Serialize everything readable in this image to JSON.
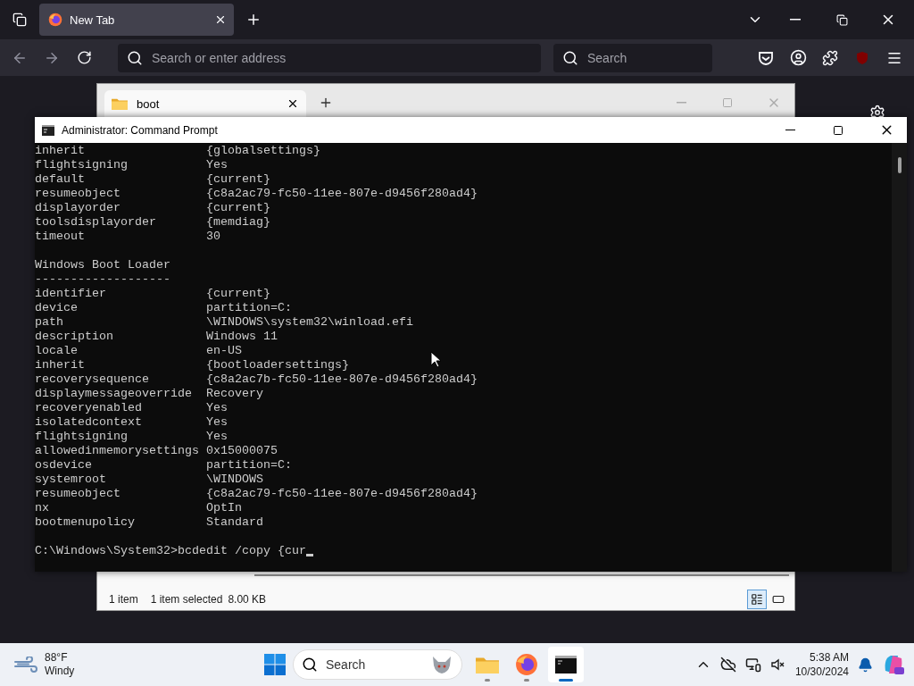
{
  "browser": {
    "tabs": [
      {
        "title": "New Tab",
        "selected": true
      }
    ],
    "address": {
      "placeholder": "Search or enter address"
    },
    "search": {
      "placeholder": "Search"
    }
  },
  "explorer": {
    "tabs": [
      {
        "title": "boot",
        "selected": true
      }
    ],
    "status": {
      "item_count": "1 item",
      "selection": "1 item selected",
      "size": "8.00 KB"
    },
    "views": [
      {
        "kind": "details",
        "selected": true
      },
      {
        "kind": "tiles",
        "selected": false
      }
    ]
  },
  "console": {
    "title": "Administrator: Command Prompt",
    "lines": [
      {
        "kind": "pair",
        "key": "inherit",
        "value": "{globalsettings}"
      },
      {
        "kind": "pair",
        "key": "flightsigning",
        "value": "Yes"
      },
      {
        "kind": "pair",
        "key": "default",
        "value": "{current}"
      },
      {
        "kind": "pair",
        "key": "resumeobject",
        "value": "{c8a2ac79-fc50-11ee-807e-d9456f280ad4}"
      },
      {
        "kind": "pair",
        "key": "displayorder",
        "value": "{current}"
      },
      {
        "kind": "pair",
        "key": "toolsdisplayorder",
        "value": "{memdiag}"
      },
      {
        "kind": "pair",
        "key": "timeout",
        "value": "30"
      },
      {
        "kind": "blank"
      },
      {
        "kind": "text",
        "text": "Windows Boot Loader"
      },
      {
        "kind": "text",
        "text": "-------------------"
      },
      {
        "kind": "pair",
        "key": "identifier",
        "value": "{current}"
      },
      {
        "kind": "pair",
        "key": "device",
        "value": "partition=C:"
      },
      {
        "kind": "pair",
        "key": "path",
        "value": "\\WINDOWS\\system32\\winload.efi"
      },
      {
        "kind": "pair",
        "key": "description",
        "value": "Windows 11"
      },
      {
        "kind": "pair",
        "key": "locale",
        "value": "en-US"
      },
      {
        "kind": "pair",
        "key": "inherit",
        "value": "{bootloadersettings}"
      },
      {
        "kind": "pair",
        "key": "recoverysequence",
        "value": "{c8a2ac7b-fc50-11ee-807e-d9456f280ad4}"
      },
      {
        "kind": "pair",
        "key": "displaymessageoverride",
        "value": "Recovery"
      },
      {
        "kind": "pair",
        "key": "recoveryenabled",
        "value": "Yes"
      },
      {
        "kind": "pair",
        "key": "isolatedcontext",
        "value": "Yes"
      },
      {
        "kind": "pair",
        "key": "flightsigning",
        "value": "Yes"
      },
      {
        "kind": "pair",
        "key": "allowedinmemorysettings",
        "value": "0x15000075"
      },
      {
        "kind": "pair",
        "key": "osdevice",
        "value": "partition=C:"
      },
      {
        "kind": "pair",
        "key": "systemroot",
        "value": "\\WINDOWS"
      },
      {
        "kind": "pair",
        "key": "resumeobject",
        "value": "{c8a2ac79-fc50-11ee-807e-d9456f280ad4}"
      },
      {
        "kind": "pair",
        "key": "nx",
        "value": "OptIn"
      },
      {
        "kind": "pair",
        "key": "bootmenupolicy",
        "value": "Standard"
      },
      {
        "kind": "blank"
      },
      {
        "kind": "prompt",
        "text": "C:\\Windows\\System32>bcdedit /copy {cur"
      }
    ]
  },
  "taskbar": {
    "weather": {
      "temperature": "88°F",
      "condition": "Windy"
    },
    "search": {
      "placeholder": "Search"
    },
    "apps": [
      {
        "kind": "explorer",
        "selected": false
      },
      {
        "kind": "firefox",
        "selected": false
      },
      {
        "kind": "terminal",
        "selected": true
      }
    ],
    "clock": {
      "time": "5:38 AM",
      "date": "10/30/2024"
    }
  }
}
